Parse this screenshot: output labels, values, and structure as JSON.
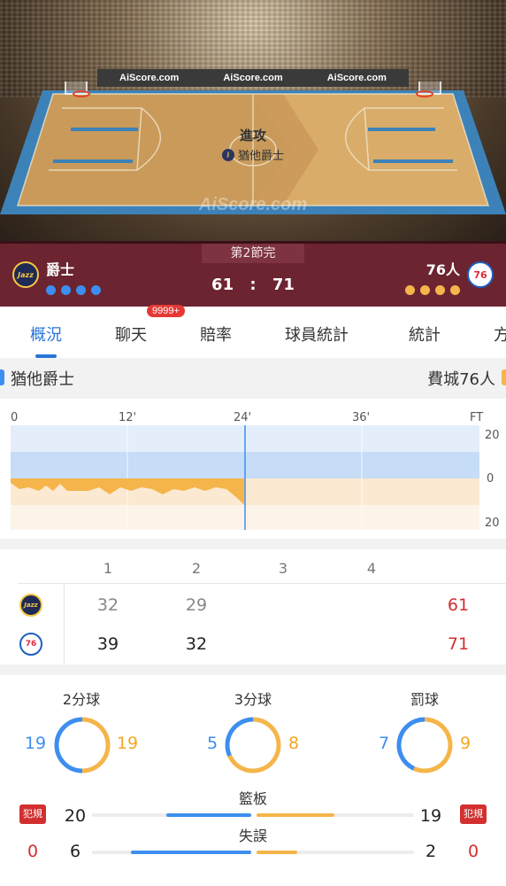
{
  "court": {
    "ads": [
      "AiScore.com",
      "AiScore.com",
      "AiScore.com"
    ],
    "possession_title": "進攻",
    "possession_team": "猶他爵士",
    "watermark": "AiScore.com"
  },
  "scoreboard": {
    "period": "第2節完",
    "home_name": "爵士",
    "away_name": "76人",
    "home_score": "61",
    "separator": ":",
    "away_score": "71",
    "home_timeouts_remaining": 4,
    "away_timeouts_remaining": 4,
    "home_logo_text": "Jazz",
    "away_logo_text": "76"
  },
  "tabs": [
    {
      "label": "概況",
      "active": true
    },
    {
      "label": "聊天",
      "badge": "9999+"
    },
    {
      "label": "賠率"
    },
    {
      "label": "球員統計"
    },
    {
      "label": "統計"
    },
    {
      "label": "方"
    }
  ],
  "momentum": {
    "home_team": "猶他爵士",
    "away_team": "費城76人",
    "x_ticks": [
      "0",
      "12'",
      "24'",
      "36'",
      "FT"
    ],
    "y_ticks": [
      "20",
      "0",
      "20"
    ],
    "current_marker": "24'"
  },
  "quarters": {
    "headers": [
      "1",
      "2",
      "3",
      "4"
    ],
    "home": {
      "q": [
        "32",
        "29",
        "",
        ""
      ],
      "total": "61"
    },
    "away": {
      "q": [
        "39",
        "32",
        "",
        ""
      ],
      "total": "71"
    }
  },
  "stats": {
    "two_pt": {
      "label": "2分球",
      "home": "19",
      "away": "19"
    },
    "three_pt": {
      "label": "3分球",
      "home": "5",
      "away": "8"
    },
    "free_throw": {
      "label": "罰球",
      "home": "7",
      "away": "9"
    },
    "foul_label": "犯規",
    "home_fouls": "0",
    "away_fouls": "0",
    "rebounds": {
      "label": "籃板",
      "home": "20",
      "away": "19"
    },
    "turnovers": {
      "label": "失誤",
      "home": "6",
      "away": "2"
    }
  },
  "colors": {
    "home": "#3d8ef0",
    "away": "#f5b54a",
    "accent": "#2874d8",
    "scoreboard": "#6b2430"
  }
}
